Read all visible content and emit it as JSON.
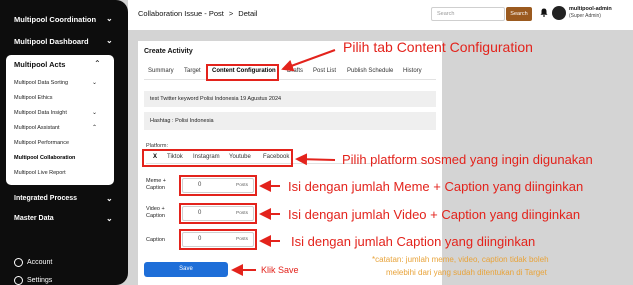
{
  "sidebar": {
    "top_items": [
      "Multipool Coordination",
      "Multipool Dashboard"
    ],
    "acts": {
      "title": "Multipool Acts",
      "items": [
        {
          "label": "Multipool Data Sorting",
          "chevron": true
        },
        {
          "label": "Multipool Ethics",
          "chevron": false
        },
        {
          "label": "Multipool Data Insight",
          "chevron": true
        },
        {
          "label": "Multipool Assistant",
          "chevron": true
        },
        {
          "label": "Multipool Performance",
          "chevron": false
        },
        {
          "label": "Multipool Collaboration",
          "chevron": false,
          "active": true
        },
        {
          "label": "Multipool Live Report",
          "chevron": false
        }
      ]
    },
    "bottom_items": [
      "Integrated Process",
      "Master Data"
    ],
    "footer": [
      "Account",
      "Settings"
    ]
  },
  "topbar": {
    "breadcrumb": [
      "Collaboration Issue - Post",
      ">",
      "Detail"
    ],
    "search_placeholder": "Search",
    "search_button": "Search",
    "user_name": "multipool-admin",
    "user_role": "(Super Admin)"
  },
  "card": {
    "title": "Create Activity",
    "tabs": [
      "Summary",
      "Target",
      "Content Configuration",
      "Drafts",
      "Post List",
      "Publish Schedule",
      "History"
    ],
    "active_tab": "Content Configuration",
    "topic": "test Twitter keyword Polisi Indonesia 19 Agustus 2024",
    "hashtag": "Hashtag : Polisi Indonesia",
    "platform_label": "Platform:",
    "platforms": [
      "X",
      "Tiktok",
      "Instagram",
      "Youtube",
      "Facebook"
    ],
    "active_platform": "X",
    "fields": [
      {
        "label_line1": "Meme +",
        "label_line2": "Caption",
        "value": "0",
        "unit": "Posts"
      },
      {
        "label_line1": "Video +",
        "label_line2": "Caption",
        "value": "0",
        "unit": "Posts"
      },
      {
        "label_line1": "Caption",
        "label_line2": "",
        "value": "0",
        "unit": "Posts"
      }
    ],
    "save_label": "Save"
  },
  "annotations": {
    "tab": "Pilih tab Content Configuration",
    "platform": "Pilih platform sosmed yang ingin digunakan",
    "meme": "Isi dengan jumlah Meme + Caption yang diinginkan",
    "video": "Isi dengan jumlah Video + Caption yang diinginkan",
    "caption": "Isi dengan jumlah Caption yang diinginkan",
    "save": "Klik Save",
    "note_line1": "*catatan: jumlah meme, video, caption tidak boleh",
    "note_line2": "melebihi dari yang sudah ditentukan di Target"
  },
  "colors": {
    "annotation": "#e3231c",
    "note": "#e8a33a",
    "save_button": "#1e6ed8",
    "search_button": "#9b5a1f",
    "sidebar": "#0d0d0d"
  }
}
